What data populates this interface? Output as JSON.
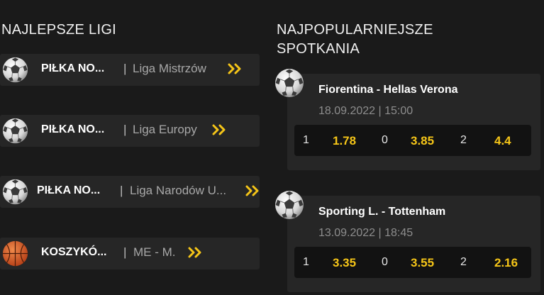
{
  "top_leagues": {
    "title": "NAJLEPSZE LIGI",
    "items": [
      {
        "sport": "PIŁKA NO...",
        "separator": "|",
        "league": "Liga Mistrzów",
        "icon": "soccer-ball-icon"
      },
      {
        "sport": "PIŁKA NO...",
        "separator": "|",
        "league": "Liga Europy",
        "icon": "soccer-ball-icon"
      },
      {
        "sport": "PIŁKA NO...",
        "separator": "|",
        "league": "Liga Narodów U...",
        "icon": "soccer-ball-icon"
      },
      {
        "sport": "KOSZYKÓ...",
        "separator": "|",
        "league": "ME - M.",
        "icon": "basketball-icon"
      }
    ]
  },
  "popular_matches": {
    "title": "NAJPOPULARNIEJSZE SPOTKANIA",
    "matches": [
      {
        "teams": "Fiorentina - Hellas Verona",
        "datetime": "18.09.2022 | 15:00",
        "icon": "soccer-ball-icon",
        "odds": [
          {
            "label": "1",
            "value": "1.78"
          },
          {
            "label": "0",
            "value": "3.85"
          },
          {
            "label": "2",
            "value": "4.4"
          }
        ]
      },
      {
        "teams": "Sporting L. - Tottenham",
        "datetime": "13.09.2022 | 18:45",
        "icon": "soccer-ball-icon",
        "odds": [
          {
            "label": "1",
            "value": "3.35"
          },
          {
            "label": "0",
            "value": "3.55"
          },
          {
            "label": "2",
            "value": "2.16"
          }
        ]
      }
    ]
  },
  "colors": {
    "background": "#1a1a1a",
    "card": "#262626",
    "odds_bg": "#121212",
    "accent": "#f5c518",
    "muted_text": "#8d8d8d"
  }
}
